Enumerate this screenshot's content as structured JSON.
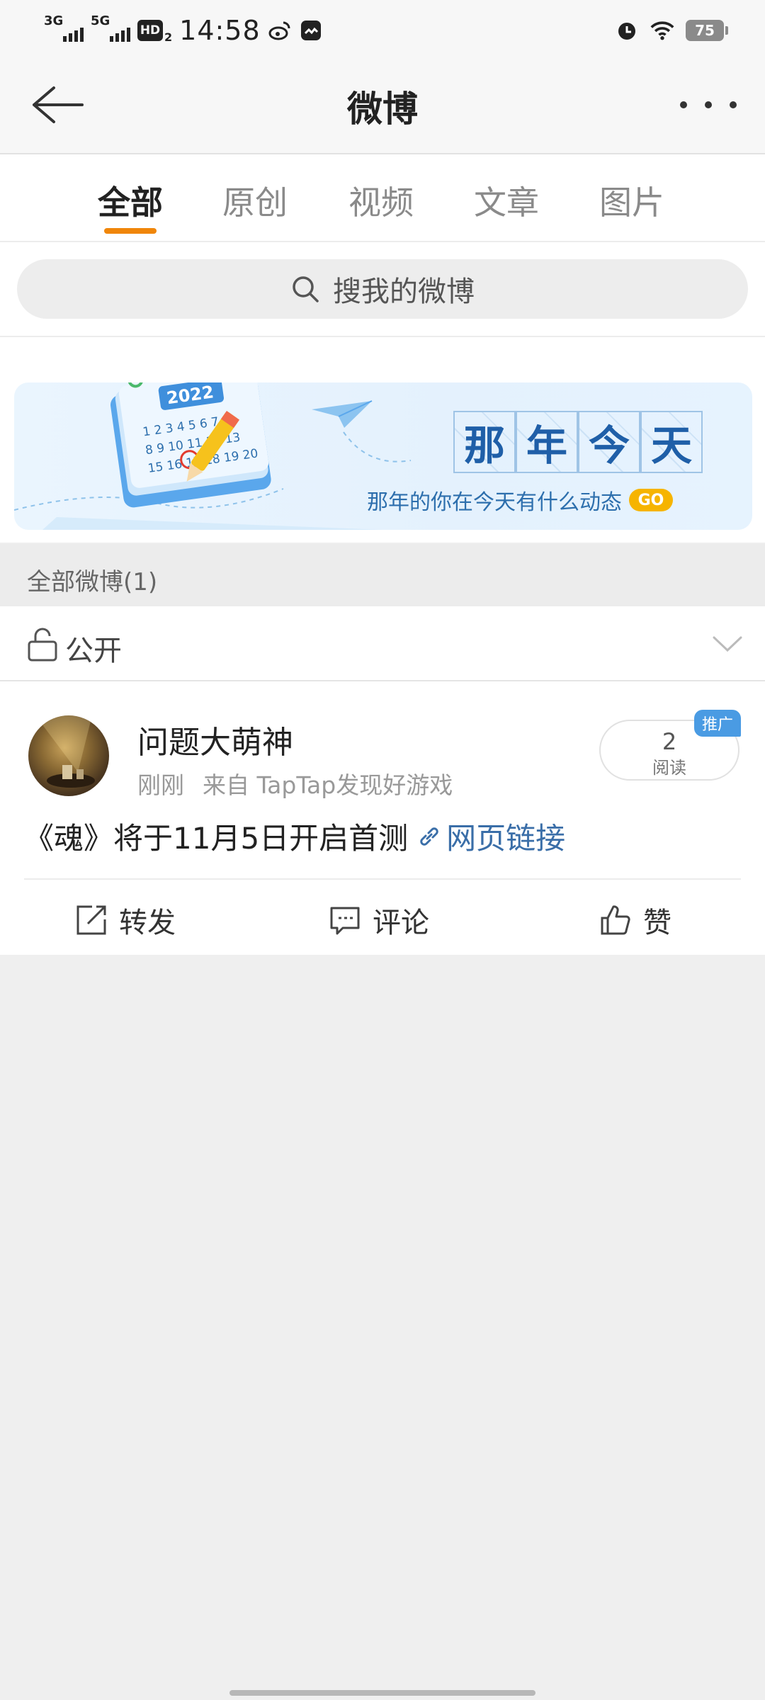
{
  "status_bar": {
    "signal_1": "3G",
    "signal_2": "5G",
    "hd_badge": "HD",
    "hd_sub": "2",
    "time": "14:58",
    "battery": "75"
  },
  "nav": {
    "title": "微博"
  },
  "tabs": [
    {
      "label": "全部",
      "active": true
    },
    {
      "label": "原创",
      "active": false
    },
    {
      "label": "视频",
      "active": false
    },
    {
      "label": "文章",
      "active": false
    },
    {
      "label": "图片",
      "active": false
    }
  ],
  "search": {
    "placeholder": "搜我的微博"
  },
  "banner": {
    "year": "2022",
    "title_chars": [
      "那",
      "年",
      "今",
      "天"
    ],
    "subtitle": "那年的你在今天有什么动态",
    "go_label": "GO"
  },
  "section": {
    "header": "全部微博(1)"
  },
  "filter": {
    "label": "公开"
  },
  "post": {
    "author": "问题大萌神",
    "time": "刚刚",
    "source": "来自 TapTap发现好游戏",
    "read_count": "2",
    "read_label": "阅读",
    "promo_badge": "推广",
    "text": "《魂》将于11月5日开启首测",
    "link_text": "网页链接",
    "actions": {
      "repost": "转发",
      "comment": "评论",
      "like": "赞"
    }
  },
  "colors": {
    "accent": "#f0860a",
    "link": "#3a6ea8",
    "promo": "#4a9be3"
  }
}
